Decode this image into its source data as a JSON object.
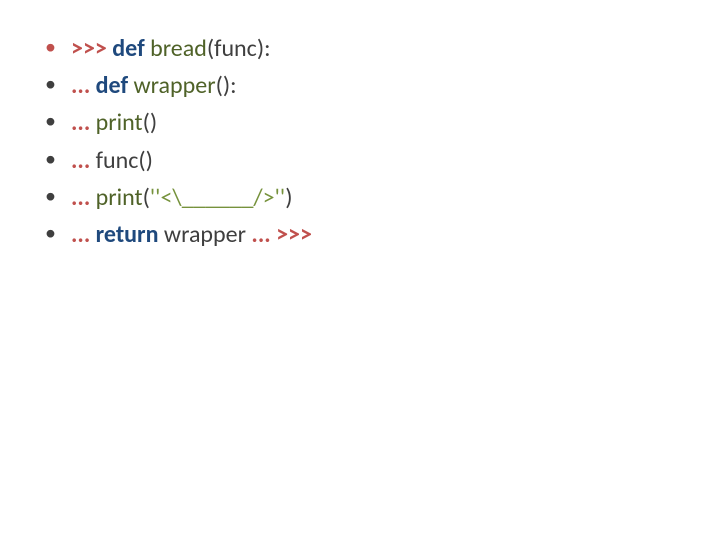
{
  "lines": [
    {
      "prompt": ">>>",
      "kw": "def",
      "ident": "bread",
      "rest": "(func):"
    },
    {
      "prompt": "...",
      "kw": "def",
      "ident": "wrapper",
      "rest": "():"
    },
    {
      "prompt": "...",
      "ident": "print",
      "rest": "()"
    },
    {
      "prompt": "...",
      "code": "func()"
    },
    {
      "prompt": "...",
      "ident": "print",
      "open": "(",
      "str": "''<\\______/>''",
      "close": ")"
    },
    {
      "prompt": "...",
      "kw": "return",
      "code": "wrapper",
      "prompt2": "...",
      "prompt3": ">>>"
    }
  ]
}
